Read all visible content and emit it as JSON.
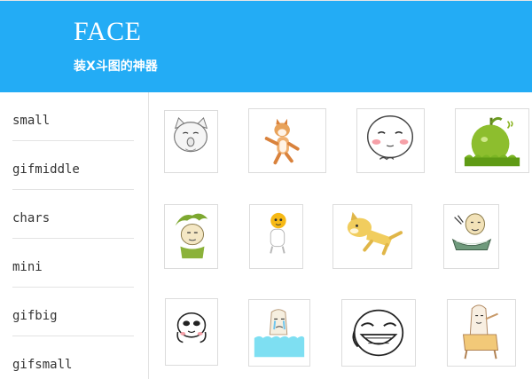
{
  "header": {
    "title": "FACE",
    "subtitle": "装X斗图的神器"
  },
  "sidebar": {
    "items": [
      {
        "label": "small"
      },
      {
        "label": "gifmiddle"
      },
      {
        "label": "chars"
      },
      {
        "label": "mini"
      },
      {
        "label": "gifbig"
      },
      {
        "label": "gifsmall"
      }
    ]
  },
  "grid": {
    "row1": [
      "white-cat-face-sticker",
      "shiba-dog-dancing-sticker",
      "blushing-panda-face-sticker",
      "green-fruit-mushroom-sticker"
    ],
    "row2": [
      "green-hair-face-sticker",
      "yellow-ball-head-sticker",
      "flying-doge-sticker",
      "man-with-bowl-sticker"
    ],
    "row3": [
      "panda-hands-on-face-sticker",
      "crying-in-water-sticker",
      "big-grin-face-sticker",
      "sitting-character-sticker"
    ]
  },
  "colors": {
    "header_bg": "#23acf5",
    "header_text": "#ffffff",
    "divider": "#e3e3e3"
  }
}
